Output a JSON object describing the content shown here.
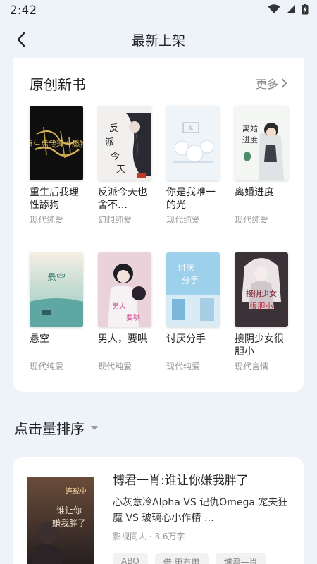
{
  "status": {
    "time": "2:42"
  },
  "header": {
    "title": "最新上架"
  },
  "new_section": {
    "title": "原创新书",
    "more_label": "更多",
    "books": [
      {
        "title": "重生后我理性舔狗",
        "genre": "现代纯爱",
        "cover_text": "重生后我理性舔狗"
      },
      {
        "title": "反派今天也舍不…",
        "genre": "幻想纯爱",
        "cover_text": "反派今天"
      },
      {
        "title": "你是我唯一的光",
        "genre": "现代纯爱",
        "cover_text": "你是我唯一的光"
      },
      {
        "title": "离婚进度",
        "genre": "现代纯爱",
        "cover_text": "离婚进度"
      },
      {
        "title": "悬空",
        "genre": "现代纯爱",
        "cover_text": "悬空"
      },
      {
        "title": "男人，要哄",
        "genre": "现代纯爱",
        "cover_text": "男人要哄"
      },
      {
        "title": "讨厌分手",
        "genre": "现代纯爱",
        "cover_text": "讨厌分手"
      },
      {
        "title": "接阴少女很胆小",
        "genre": "现代言情",
        "cover_text": "接阴少女很胆小"
      }
    ]
  },
  "rank_section": {
    "title": "点击量排序",
    "book": {
      "title": "博君一肖:谁让你嫌我胖了",
      "desc": "心灰意冷Alpha VS 记仇Omega 宠夫狂魔 VS 玻璃心小作精 …",
      "meta": "影视同人 · 3.6万字",
      "cover_text": "谁让你嫌我胖了",
      "cover_badge": "连载中",
      "tags": [
        "ABO",
        "借 更有用",
        "博君一肖"
      ]
    }
  }
}
